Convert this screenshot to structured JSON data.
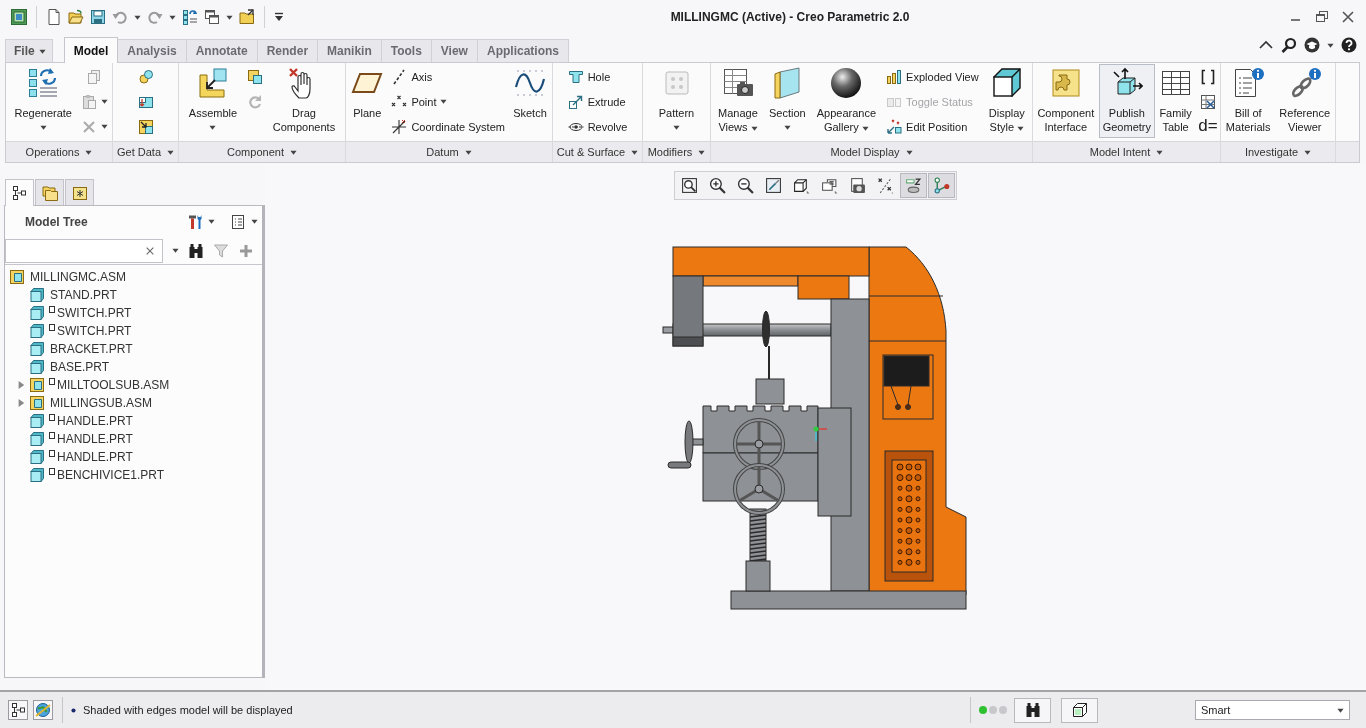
{
  "window": {
    "title": "MILLINGMC (Active) - Creo Parametric 2.0"
  },
  "file_menu": {
    "label": "File",
    "dropdown": true
  },
  "ribbon_tabs": [
    {
      "label": "Model",
      "selected": true
    },
    {
      "label": "Analysis",
      "selected": false
    },
    {
      "label": "Annotate",
      "selected": false
    },
    {
      "label": "Render",
      "selected": false
    },
    {
      "label": "Manikin",
      "selected": false
    },
    {
      "label": "Tools",
      "selected": false
    },
    {
      "label": "View",
      "selected": false
    },
    {
      "label": "Applications",
      "selected": false
    }
  ],
  "ribbon_groups": [
    {
      "label": "Operations",
      "dropdown": true,
      "items": [
        {
          "kind": "large",
          "label": "Regenerate",
          "dropdown": true,
          "highlighted": false
        },
        {
          "kind": "tools"
        }
      ]
    },
    {
      "label": "Get Data",
      "dropdown": true,
      "items": [
        {
          "kind": "tools"
        }
      ]
    },
    {
      "label": "Component",
      "dropdown": true,
      "items": [
        {
          "kind": "large",
          "label": "Assemble",
          "dropdown": true,
          "highlighted": false
        },
        {
          "kind": "tools"
        },
        {
          "kind": "large",
          "label": "Drag\nComponents",
          "dropdown": false,
          "highlighted": false
        }
      ]
    },
    {
      "label": "Datum",
      "dropdown": true,
      "items": [
        {
          "kind": "large",
          "label": "Plane",
          "dropdown": false,
          "highlighted": false
        },
        {
          "kind": "stack",
          "buttons": [
            {
              "label": "Axis",
              "dropdown": false,
              "disabled": false
            },
            {
              "label": "Point",
              "dropdown": true,
              "disabled": false
            },
            {
              "label": "Coordinate System",
              "dropdown": false,
              "disabled": false
            }
          ]
        },
        {
          "kind": "large",
          "label": "Sketch",
          "dropdown": false,
          "highlighted": false
        }
      ]
    },
    {
      "label": "Cut & Surface",
      "dropdown": true,
      "items": [
        {
          "kind": "stack",
          "buttons": [
            {
              "label": "Hole",
              "dropdown": false,
              "disabled": false
            },
            {
              "label": "Extrude",
              "dropdown": false,
              "disabled": false
            },
            {
              "label": "Revolve",
              "dropdown": false,
              "disabled": false
            }
          ]
        }
      ]
    },
    {
      "label": "Modifiers",
      "dropdown": true,
      "items": [
        {
          "kind": "large",
          "label": "Pattern",
          "dropdown": true,
          "highlighted": false
        }
      ]
    },
    {
      "label": "Model Display",
      "dropdown": true,
      "items": [
        {
          "kind": "large",
          "label": "Manage\nViews",
          "dropdown": true,
          "highlighted": false
        },
        {
          "kind": "large",
          "label": "Section",
          "dropdown": true,
          "highlighted": false
        },
        {
          "kind": "large",
          "label": "Appearance\nGallery",
          "dropdown": true,
          "highlighted": false
        },
        {
          "kind": "stack",
          "buttons": [
            {
              "label": "Exploded View",
              "dropdown": false,
              "disabled": false
            },
            {
              "label": "Toggle Status",
              "dropdown": false,
              "disabled": true
            },
            {
              "label": "Edit Position",
              "dropdown": false,
              "disabled": false
            }
          ]
        },
        {
          "kind": "large",
          "label": "Display\nStyle",
          "dropdown": true,
          "highlighted": false
        }
      ]
    },
    {
      "label": "Model Intent",
      "dropdown": true,
      "items": [
        {
          "kind": "large",
          "label": "Component\nInterface",
          "dropdown": false,
          "highlighted": false
        },
        {
          "kind": "large",
          "label": "Publish\nGeometry",
          "dropdown": false,
          "highlighted": true
        },
        {
          "kind": "large",
          "label": "Family\nTable",
          "dropdown": false,
          "highlighted": false
        },
        {
          "kind": "tools",
          "glyph": "d="
        }
      ]
    },
    {
      "label": "Investigate",
      "dropdown": true,
      "items": [
        {
          "kind": "large",
          "label": "Bill of\nMaterials",
          "dropdown": false,
          "highlighted": false
        },
        {
          "kind": "large",
          "label": "Reference\nViewer",
          "dropdown": false,
          "highlighted": false
        }
      ]
    }
  ],
  "navigator_tabs": [
    {
      "selected": true
    },
    {
      "selected": false
    },
    {
      "selected": false
    }
  ],
  "model_tree": {
    "title": "Model Tree",
    "items": [
      {
        "label": "MILLINGMC.ASM",
        "kind": "assembly",
        "status_marker": false,
        "selected": false,
        "children": [
          {
            "label": "STAND.PRT",
            "kind": "part",
            "status_marker": false,
            "selected": false
          },
          {
            "label": "SWITCH.PRT",
            "kind": "part",
            "status_marker": true,
            "selected": false
          },
          {
            "label": "SWITCH.PRT",
            "kind": "part",
            "status_marker": true,
            "selected": false
          },
          {
            "label": "BRACKET.PRT",
            "kind": "part",
            "status_marker": false,
            "selected": false
          },
          {
            "label": "BASE.PRT",
            "kind": "part",
            "status_marker": false,
            "selected": false
          },
          {
            "label": "MILLTOOLSUB.ASM",
            "kind": "assembly",
            "status_marker": true,
            "selected": false,
            "expanded": false
          },
          {
            "label": "MILLINGSUB.ASM",
            "kind": "assembly",
            "status_marker": false,
            "selected": false,
            "expanded": false
          },
          {
            "label": "HANDLE.PRT",
            "kind": "part",
            "status_marker": true,
            "selected": false
          },
          {
            "label": "HANDLE.PRT",
            "kind": "part",
            "status_marker": true,
            "selected": false
          },
          {
            "label": "HANDLE.PRT",
            "kind": "part",
            "status_marker": true,
            "selected": false
          },
          {
            "label": "BENCHIVICE1.PRT",
            "kind": "part",
            "status_marker": true,
            "selected": false
          }
        ]
      }
    ]
  },
  "view_toolbar": {
    "buttons": [
      {
        "on": false
      },
      {
        "on": false
      },
      {
        "on": false
      },
      {
        "on": false
      },
      {
        "on": false
      },
      {
        "on": false
      },
      {
        "on": false
      },
      {
        "on": false
      },
      {
        "on": true
      },
      {
        "on": true
      }
    ]
  },
  "status_bar": {
    "message": "Shaded with edges model will be displayed",
    "lights": [
      {
        "color": "#2fc12f"
      },
      {
        "color": "#c8c8cc"
      },
      {
        "color": "#c8c8cc"
      }
    ],
    "selection_filter": {
      "value": "Smart"
    }
  }
}
